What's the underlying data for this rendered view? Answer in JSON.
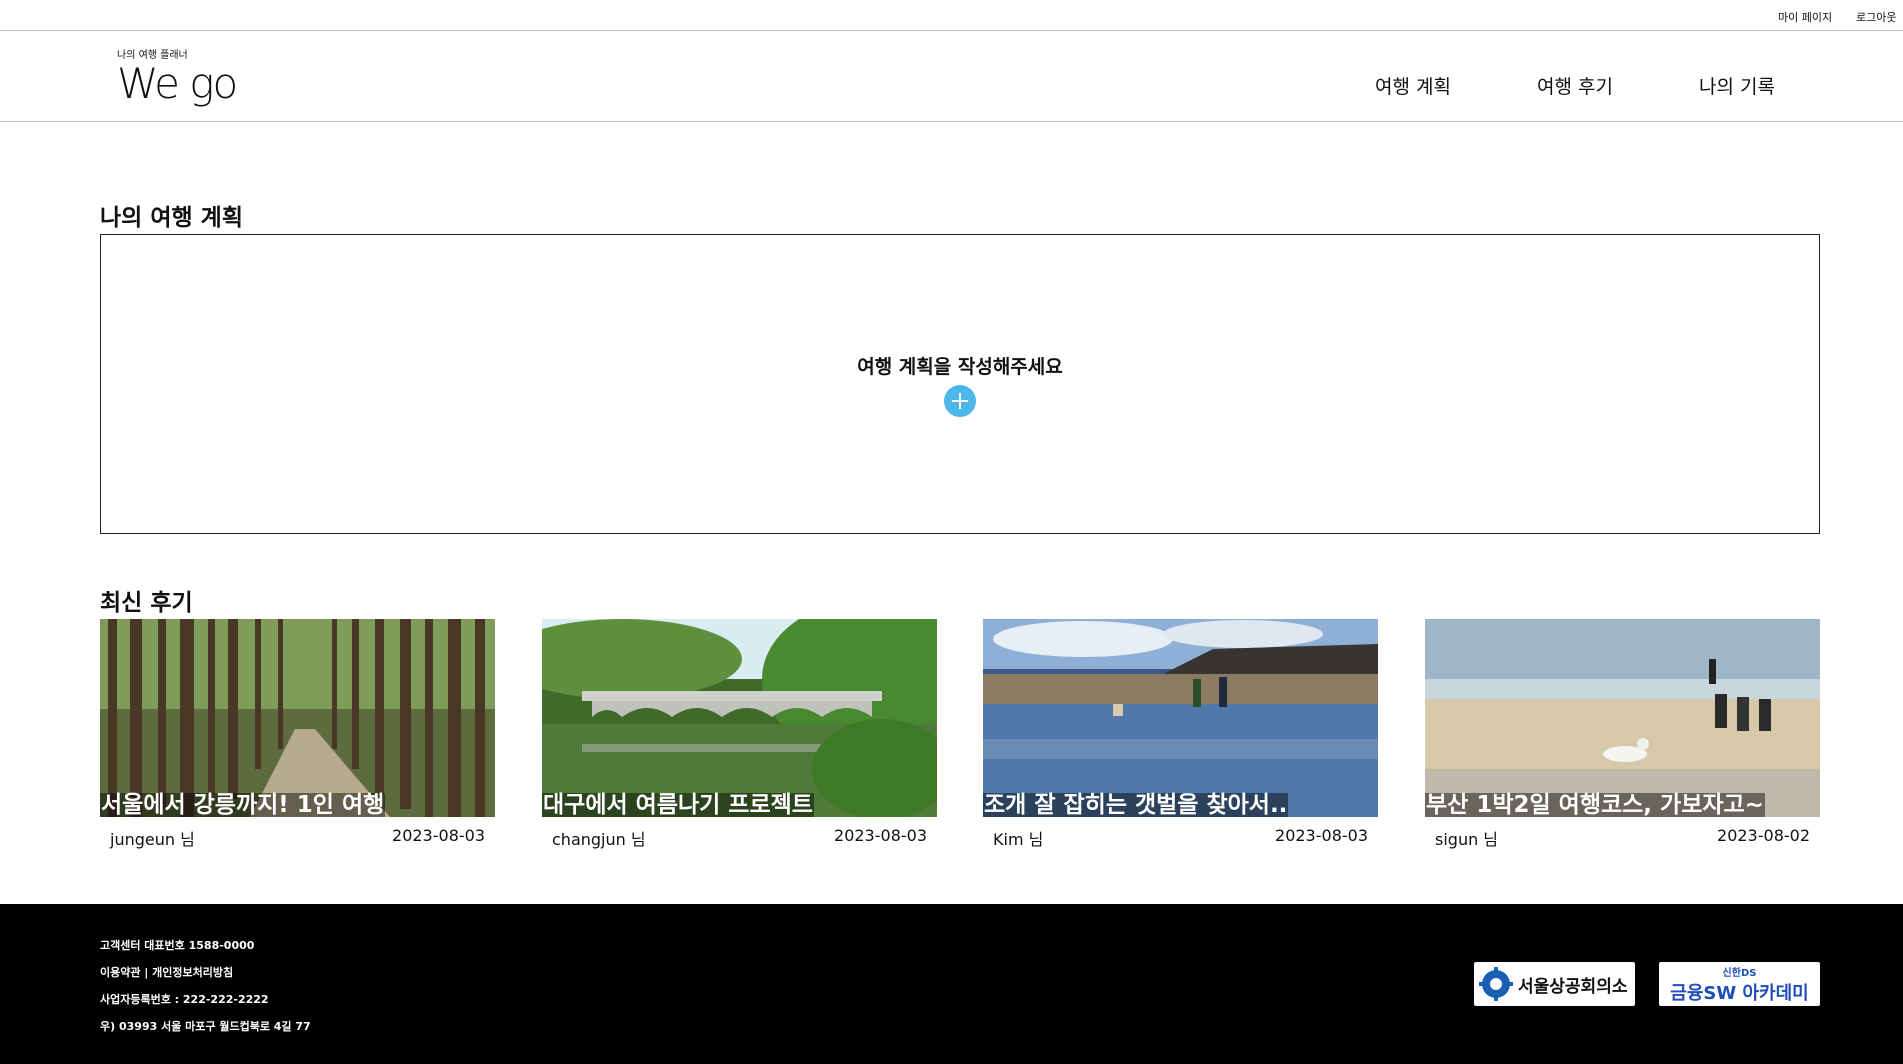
{
  "top_links": {
    "mypage": "마이 페이지",
    "logout": "로그아웃"
  },
  "logo": {
    "subtitle": "나의 여행 플래너",
    "title": "We go"
  },
  "nav": [
    "여행 계획",
    "여행 후기",
    "나의 기록"
  ],
  "plan_section": {
    "title": "나의 여행 계획",
    "empty_message": "여행 계획을 작성해주세요",
    "add_icon": "plus-circle-icon"
  },
  "review_section": {
    "title": "최신 후기",
    "cards": [
      {
        "title": "서울에서 강릉까지! 1인 여행",
        "user": "jungeun 님",
        "date": "2023-08-03"
      },
      {
        "title": "대구에서 여름나기 프로젝트",
        "user": "changjun 님",
        "date": "2023-08-03"
      },
      {
        "title": "조개 잘 잡히는 갯벌을 찾아서..",
        "user": "Kim 님",
        "date": "2023-08-03"
      },
      {
        "title": "부산 1박2일 여행코스, 가보자고~",
        "user": "sigun 님",
        "date": "2023-08-02"
      }
    ]
  },
  "footer": {
    "lines": [
      "고객센터 대표번호 1588-0000",
      "이용약관 | 개인정보처리방침",
      "사업자등록번호 : 222-222-2222",
      "우) 03993 서울 마포구 월드컵북로 4길 77"
    ],
    "sponsor1": "서울상공회의소",
    "sponsor2_top": "신한DS",
    "sponsor2_bottom": "금융SW 아카데미"
  },
  "colors": {
    "accent": "#4fb6ea",
    "footer_bg": "#000000",
    "sponsor_blue": "#1f4eb8"
  }
}
